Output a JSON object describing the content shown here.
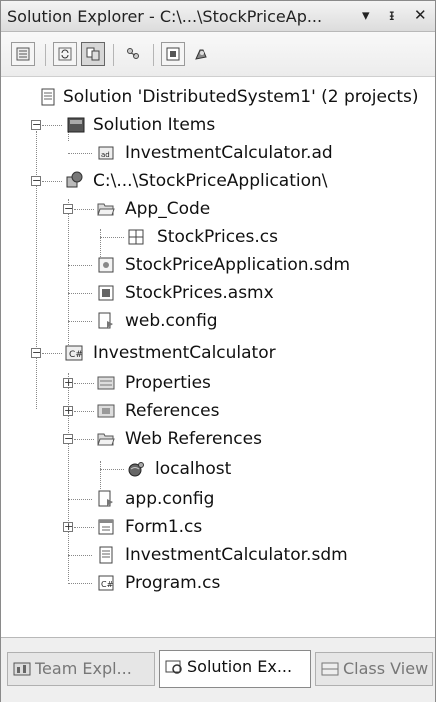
{
  "titlebar": {
    "title": "Solution Explorer - C:\\...\\StockPriceAp...",
    "dropdown_glyph": "▾",
    "pin_glyph": "ᵻ",
    "close_glyph": "✕"
  },
  "toolbar": {
    "icons": [
      "properties-icon",
      "refresh-icon",
      "show-all-files-icon",
      "view-class-diagram-icon",
      "view-designer-icon",
      "nested-related-files-icon"
    ]
  },
  "tree": {
    "solution": "Solution 'DistributedSystem1' (2 projects)",
    "solution_items": "Solution Items",
    "investment_ad": "InvestmentCalculator.ad",
    "stock_project": "C:\\...\\StockPriceApplication\\",
    "app_code": "App_Code",
    "stockprices_cs": "StockPrices.cs",
    "stock_sdm": "StockPriceApplication.sdm",
    "stockprices_asmx": "StockPrices.asmx",
    "web_config": "web.config",
    "investment_project": "InvestmentCalculator",
    "properties": "Properties",
    "references": "References",
    "web_references": "Web References",
    "localhost": "localhost",
    "app_config": "app.config",
    "form1": "Form1.cs",
    "investment_sdm": "InvestmentCalculator.sdm",
    "program": "Program.cs"
  },
  "tabs": {
    "team": "Team Expl...",
    "solution": "Solution Ex...",
    "class": "Class View"
  }
}
